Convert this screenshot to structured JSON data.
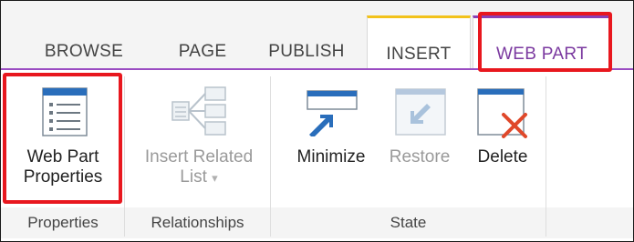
{
  "tabs": [
    {
      "id": "browse",
      "label": "BROWSE"
    },
    {
      "id": "page",
      "label": "PAGE"
    },
    {
      "id": "publish",
      "label": "PUBLISH"
    },
    {
      "id": "insert",
      "label": "INSERT"
    },
    {
      "id": "webpart",
      "label": "WEB PART",
      "selected": true
    }
  ],
  "ribbon": {
    "properties": {
      "button_label_line1": "Web Part",
      "button_label_line2": "Properties",
      "group_label": "Properties"
    },
    "relationships": {
      "button_label_line1": "Insert Related",
      "button_label_line2": "List",
      "dropdown_glyph": "▾",
      "group_label": "Relationships",
      "enabled": false
    },
    "state": {
      "minimize_label": "Minimize",
      "restore_label": "Restore",
      "delete_label": "Delete",
      "restore_enabled": false,
      "group_label": "State"
    }
  },
  "icons": {
    "properties": "properties-list-icon",
    "insert_related": "related-list-icon",
    "minimize": "minimize-window-icon",
    "restore": "restore-window-icon",
    "delete": "delete-window-icon"
  },
  "colors": {
    "selected_tab_text": "#7b3aa0",
    "selected_tab_accent": "#8a3fb5",
    "insert_tab_accent": "#f2c21b",
    "highlight_border": "#e8171e",
    "icon_blue": "#2a6ebb",
    "delete_red": "#e0482a"
  }
}
